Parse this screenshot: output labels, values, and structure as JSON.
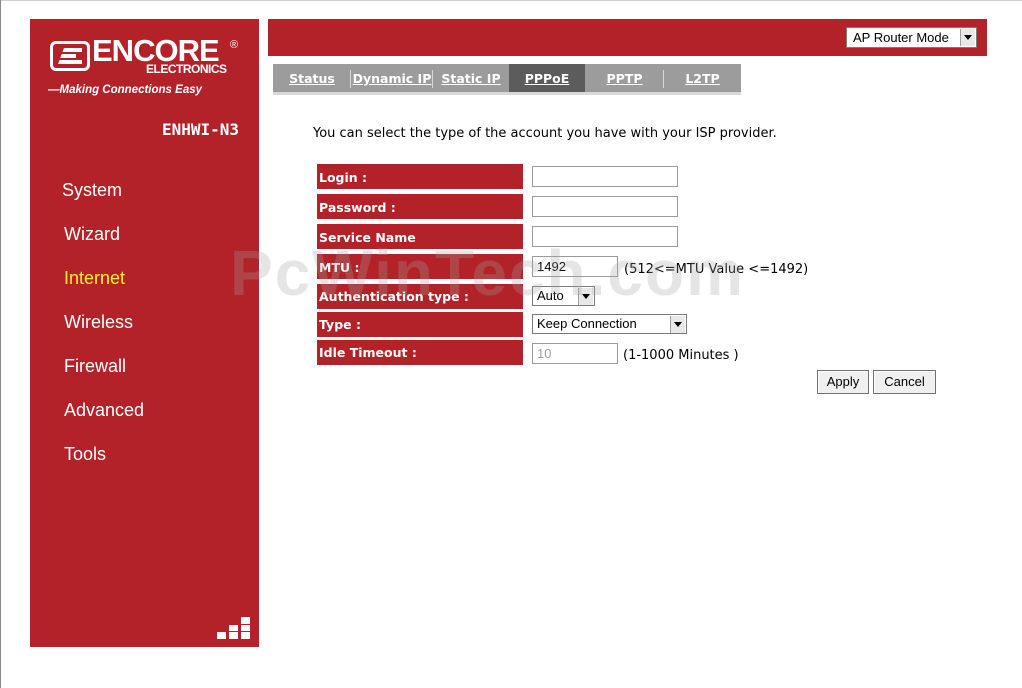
{
  "brand": {
    "name": "ENCORE",
    "sub": "ELECTRONICS",
    "registered": "®",
    "tagline": "—Making Connections Easy",
    "model": "ENHWI-N3"
  },
  "sidebar": {
    "items": [
      {
        "label": "System"
      },
      {
        "label": "Wizard"
      },
      {
        "label": "Internet"
      },
      {
        "label": "Wireless"
      },
      {
        "label": "Firewall"
      },
      {
        "label": "Advanced"
      },
      {
        "label": "Tools"
      }
    ],
    "active": "Internet"
  },
  "topbar": {
    "mode_select": "AP Router Mode"
  },
  "tabs": [
    {
      "label": "Status"
    },
    {
      "label": "Dynamic IP"
    },
    {
      "label": "Static IP"
    },
    {
      "label": "PPPoE"
    },
    {
      "label": "PPTP"
    },
    {
      "label": "L2TP"
    }
  ],
  "active_tab": "PPPoE",
  "form": {
    "intro": "You can select the type of the account you have with your ISP provider.",
    "login": {
      "label": "Login :",
      "value": ""
    },
    "password": {
      "label": "Password :",
      "value": ""
    },
    "service_name": {
      "label": "Service Name",
      "value": ""
    },
    "mtu": {
      "label": "MTU :",
      "value": "1492",
      "hint": "(512<=MTU Value <=1492)"
    },
    "auth_type": {
      "label": "Authentication type :",
      "value": "Auto"
    },
    "type": {
      "label": "Type :",
      "value": "Keep Connection"
    },
    "idle_timeout": {
      "label": "Idle Timeout :",
      "value": "10",
      "hint": "(1-1000 Minutes )"
    },
    "apply_label": "Apply",
    "cancel_label": "Cancel"
  },
  "watermark": "PcWinTech.com",
  "colors": {
    "brand_red": "#b22228",
    "active_nav": "#ffee33",
    "tab_bar": "#9c9c9c",
    "tab_active": "#5c5c5c"
  }
}
